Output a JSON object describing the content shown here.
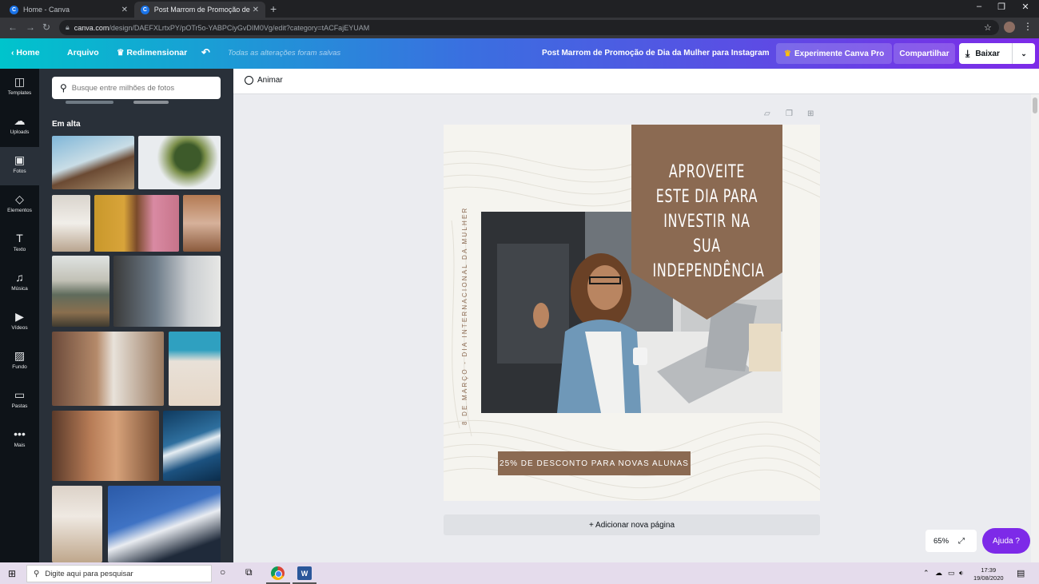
{
  "browser": {
    "tabs": [
      {
        "title": "Home - Canva",
        "active": false
      },
      {
        "title": "Post Marrom de Promoção de Di",
        "active": true
      }
    ],
    "new_tab": "+",
    "url_host": "canva.com",
    "url_path": "/design/DAEFXLrtxPY/pOTr5o-YABPCiyGvDIM0Vg/edit?category=tACFajEYUAM",
    "window_controls": {
      "minimize": "–",
      "maximize": "❐",
      "close": "✕"
    }
  },
  "header": {
    "home": "Home",
    "file": "Arquivo",
    "resize": "Redimensionar",
    "undo": "↶",
    "saved_status": "Todas as alterações foram salvas",
    "design_title": "Post Marrom de Promoção de Dia da Mulher para Instagram",
    "pro_button": "Experimente Canva Pro",
    "share_button": "Compartilhar",
    "download_button": "Baixar"
  },
  "rail": {
    "items": [
      {
        "label": "Templates",
        "icon": "◫"
      },
      {
        "label": "Uploads",
        "icon": "☁"
      },
      {
        "label": "Fotos",
        "icon": "▣"
      },
      {
        "label": "Elementos",
        "icon": "◇"
      },
      {
        "label": "Texto",
        "icon": "T"
      },
      {
        "label": "Música",
        "icon": "♫"
      },
      {
        "label": "Vídeos",
        "icon": "▶"
      },
      {
        "label": "Fundo",
        "icon": "▨"
      },
      {
        "label": "Pastas",
        "icon": "▭"
      },
      {
        "label": "Mais",
        "icon": "•••"
      }
    ]
  },
  "panel": {
    "search_placeholder": "Busque entre milhões de fotos",
    "heading": "Em alta"
  },
  "editor": {
    "animate": "Animar",
    "add_page": "+ Adicionar nova página",
    "zoom": "65%",
    "help": "Ajuda ?"
  },
  "design": {
    "headline_lines": [
      "APROVEITE",
      "ESTE DIA PARA",
      "INVESTIR NA SUA",
      "INDEPENDÊNCIA"
    ],
    "vertical_text": "8 DE MARÇO - DIA INTERNACIONAL DA MULHER",
    "cta": "25% DE DESCONTO PARA NOVAS ALUNAS",
    "colors": {
      "brown": "#8b6a52",
      "background": "#f5f4ef"
    }
  },
  "taskbar": {
    "search_placeholder": "Digite aqui para pesquisar",
    "time": "17:39",
    "date": "19/08/2020"
  }
}
